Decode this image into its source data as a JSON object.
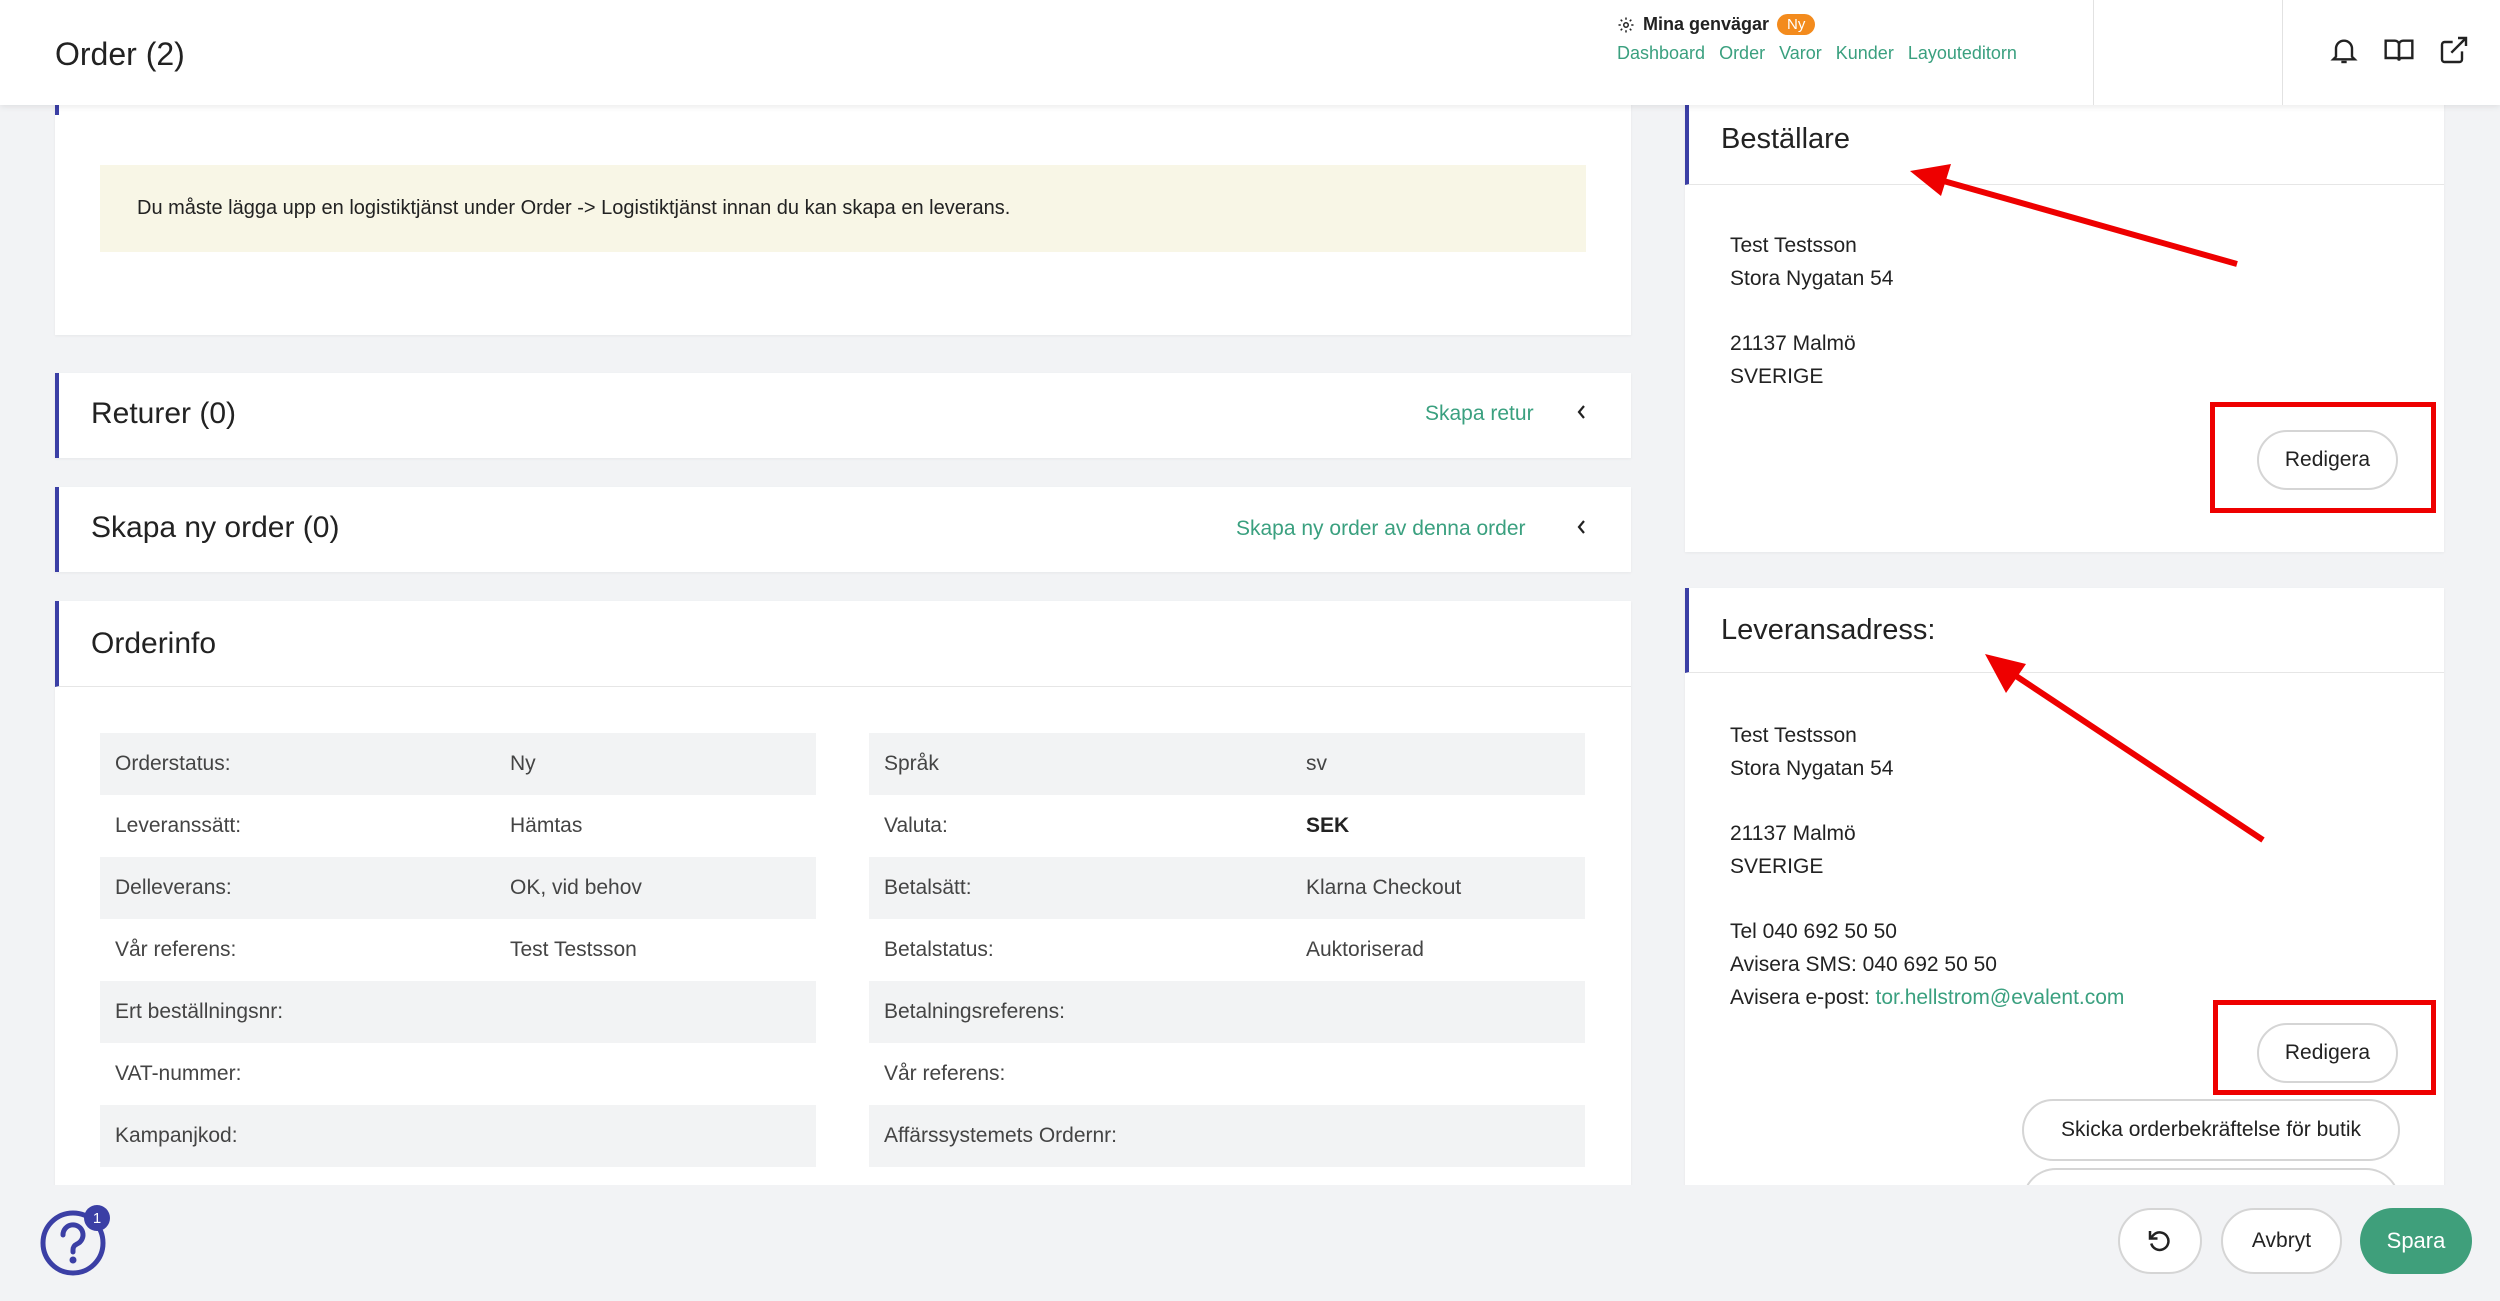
{
  "header": {
    "title": "Order (2)",
    "shortcuts_title": "Mina genvägar",
    "shortcuts_badge": "Ny",
    "shortcut_links": [
      "Dashboard",
      "Order",
      "Varor",
      "Kunder",
      "Layouteditorn"
    ]
  },
  "notice": {
    "text": "Du måste lägga upp en logistiktjänst under Order -> Logistiktjänst innan du kan skapa en leverans."
  },
  "returns": {
    "title": "Returer (0)",
    "action": "Skapa retur"
  },
  "new_order": {
    "title": "Skapa ny order (0)",
    "action": "Skapa ny order av denna order"
  },
  "orderinfo": {
    "title": "Orderinfo",
    "left": [
      {
        "label": "Orderstatus:",
        "value": "Ny"
      },
      {
        "label": "Leveranssätt:",
        "value": "Hämtas"
      },
      {
        "label": "Delleverans:",
        "value": "OK, vid behov"
      },
      {
        "label": "Vår referens:",
        "value": "Test Testsson"
      },
      {
        "label": "Ert beställningsnr:",
        "value": ""
      },
      {
        "label": "VAT-nummer:",
        "value": ""
      },
      {
        "label": "Kampanjkod:",
        "value": ""
      }
    ],
    "right": [
      {
        "label": "Språk",
        "value": "sv"
      },
      {
        "label": "Valuta:",
        "value": "SEK"
      },
      {
        "label": "Betalsätt:",
        "value": "Klarna Checkout"
      },
      {
        "label": "Betalstatus:",
        "value": "Auktoriserad"
      },
      {
        "label": "Betalningsreferens:",
        "value": ""
      },
      {
        "label": "Vår referens:",
        "value": ""
      },
      {
        "label": "Affärssystemets Ordernr:",
        "value": ""
      }
    ]
  },
  "orderer": {
    "title": "Beställare",
    "name": "Test Testsson",
    "street": "Stora Nygatan 54",
    "city": "21137 Malmö",
    "country": "SVERIGE",
    "edit_label": "Redigera"
  },
  "delivery": {
    "title": "Leveransadress:",
    "name": "Test Testsson",
    "street": "Stora Nygatan 54",
    "city": "21137 Malmö",
    "country": "SVERIGE",
    "phone": "Tel 040 692 50 50",
    "sms": "Avisera SMS: 040 692 50 50",
    "email_label": "Avisera e-post: ",
    "email": "tor.hellstrom@evalent.com",
    "edit_label": "Redigera",
    "send_confirmation": "Skicka orderbekräftelse för butik"
  },
  "footer": {
    "help_count": "1",
    "cancel_label": "Avbryt",
    "save_label": "Spara"
  },
  "colors": {
    "accent_green": "#3f9f7b",
    "link_green": "#3aa07f",
    "header_indicator": "#3b3fa5",
    "badge_orange": "#f38b1d",
    "annotation_red": "#ee0000"
  },
  "icons": [
    "gear-icon",
    "bell-icon",
    "book-icon",
    "external-link-icon",
    "chevron-left-icon",
    "help-icon",
    "undo-icon"
  ]
}
